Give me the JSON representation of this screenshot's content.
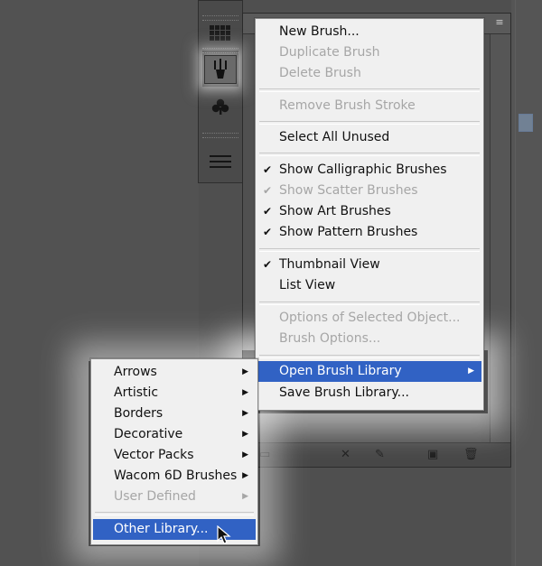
{
  "brush_menu": {
    "items": [
      {
        "label": "New Brush...",
        "checked": false,
        "disabled": false,
        "submenu": false
      },
      {
        "label": "Duplicate Brush",
        "checked": false,
        "disabled": true,
        "submenu": false
      },
      {
        "label": "Delete Brush",
        "checked": false,
        "disabled": true,
        "submenu": false
      },
      {
        "label": "Remove Brush Stroke",
        "checked": false,
        "disabled": true,
        "submenu": false
      },
      {
        "label": "Select All Unused",
        "checked": false,
        "disabled": false,
        "submenu": false
      },
      {
        "label": "Show Calligraphic Brushes",
        "checked": true,
        "disabled": false,
        "submenu": false
      },
      {
        "label": "Show Scatter Brushes",
        "checked": true,
        "disabled": true,
        "submenu": false
      },
      {
        "label": "Show Art Brushes",
        "checked": true,
        "disabled": false,
        "submenu": false
      },
      {
        "label": "Show Pattern Brushes",
        "checked": true,
        "disabled": false,
        "submenu": false
      },
      {
        "label": "Thumbnail View",
        "checked": true,
        "disabled": false,
        "submenu": false
      },
      {
        "label": "List View",
        "checked": false,
        "disabled": false,
        "submenu": false
      },
      {
        "label": "Options of Selected Object...",
        "checked": false,
        "disabled": true,
        "submenu": false
      },
      {
        "label": "Brush Options...",
        "checked": false,
        "disabled": true,
        "submenu": false
      },
      {
        "label": "Open Brush Library",
        "checked": false,
        "disabled": false,
        "submenu": true,
        "highlighted": true
      },
      {
        "label": "Save Brush Library...",
        "checked": false,
        "disabled": false,
        "submenu": false
      }
    ]
  },
  "library_submenu": {
    "items": [
      {
        "label": "Arrows",
        "disabled": false,
        "submenu": true
      },
      {
        "label": "Artistic",
        "disabled": false,
        "submenu": true
      },
      {
        "label": "Borders",
        "disabled": false,
        "submenu": true
      },
      {
        "label": "Decorative",
        "disabled": false,
        "submenu": true
      },
      {
        "label": "Vector Packs",
        "disabled": false,
        "submenu": true
      },
      {
        "label": "Wacom 6D Brushes",
        "disabled": false,
        "submenu": true
      },
      {
        "label": "User Defined",
        "disabled": true,
        "submenu": true
      },
      {
        "label": "Other Library...",
        "disabled": false,
        "submenu": false,
        "highlighted": true
      }
    ]
  },
  "glyphs": {
    "check": "✔",
    "arrow": "▶"
  },
  "icons": {
    "tool_grid": "swatches-grid-icon",
    "tool_brush": "brushes-icon",
    "tool_club": "symbols-icon",
    "tool_lines": "stroke-icon"
  },
  "colors": {
    "menu_bg": "#f0f0f0",
    "highlight": "#3162c4",
    "disabled_text": "#a6a6a6"
  }
}
